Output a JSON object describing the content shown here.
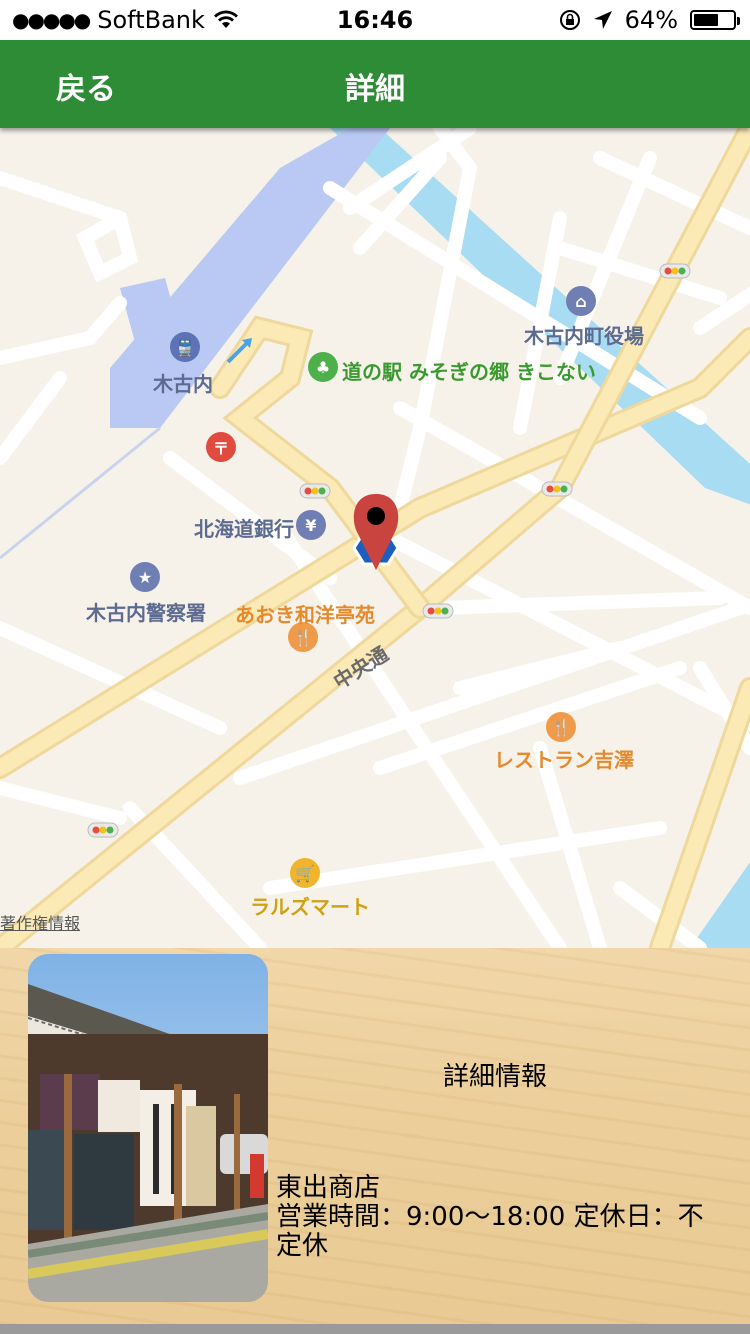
{
  "status_bar": {
    "carrier": "SoftBank",
    "time": "16:46",
    "battery": "64%",
    "battery_level": 0.64
  },
  "nav": {
    "back_label": "戻る",
    "title": "詳細"
  },
  "map": {
    "pois": {
      "station": "木古内",
      "michinoeki": "道の駅 みそぎの郷 きこない",
      "town_office": "木古内町役場",
      "bank": "北海道銀行",
      "police": "木古内警察署",
      "restaurant1": "あおき和洋亭苑",
      "restaurant2": "レストラン吉澤",
      "mart": "ラルズマート"
    },
    "road": "中央通",
    "credits": "著作権情報"
  },
  "panel": {
    "section_title": "詳細情報",
    "shop_name": "東出商店",
    "hours": "営業時間：9:00〜18:00 定休日：不定休"
  }
}
